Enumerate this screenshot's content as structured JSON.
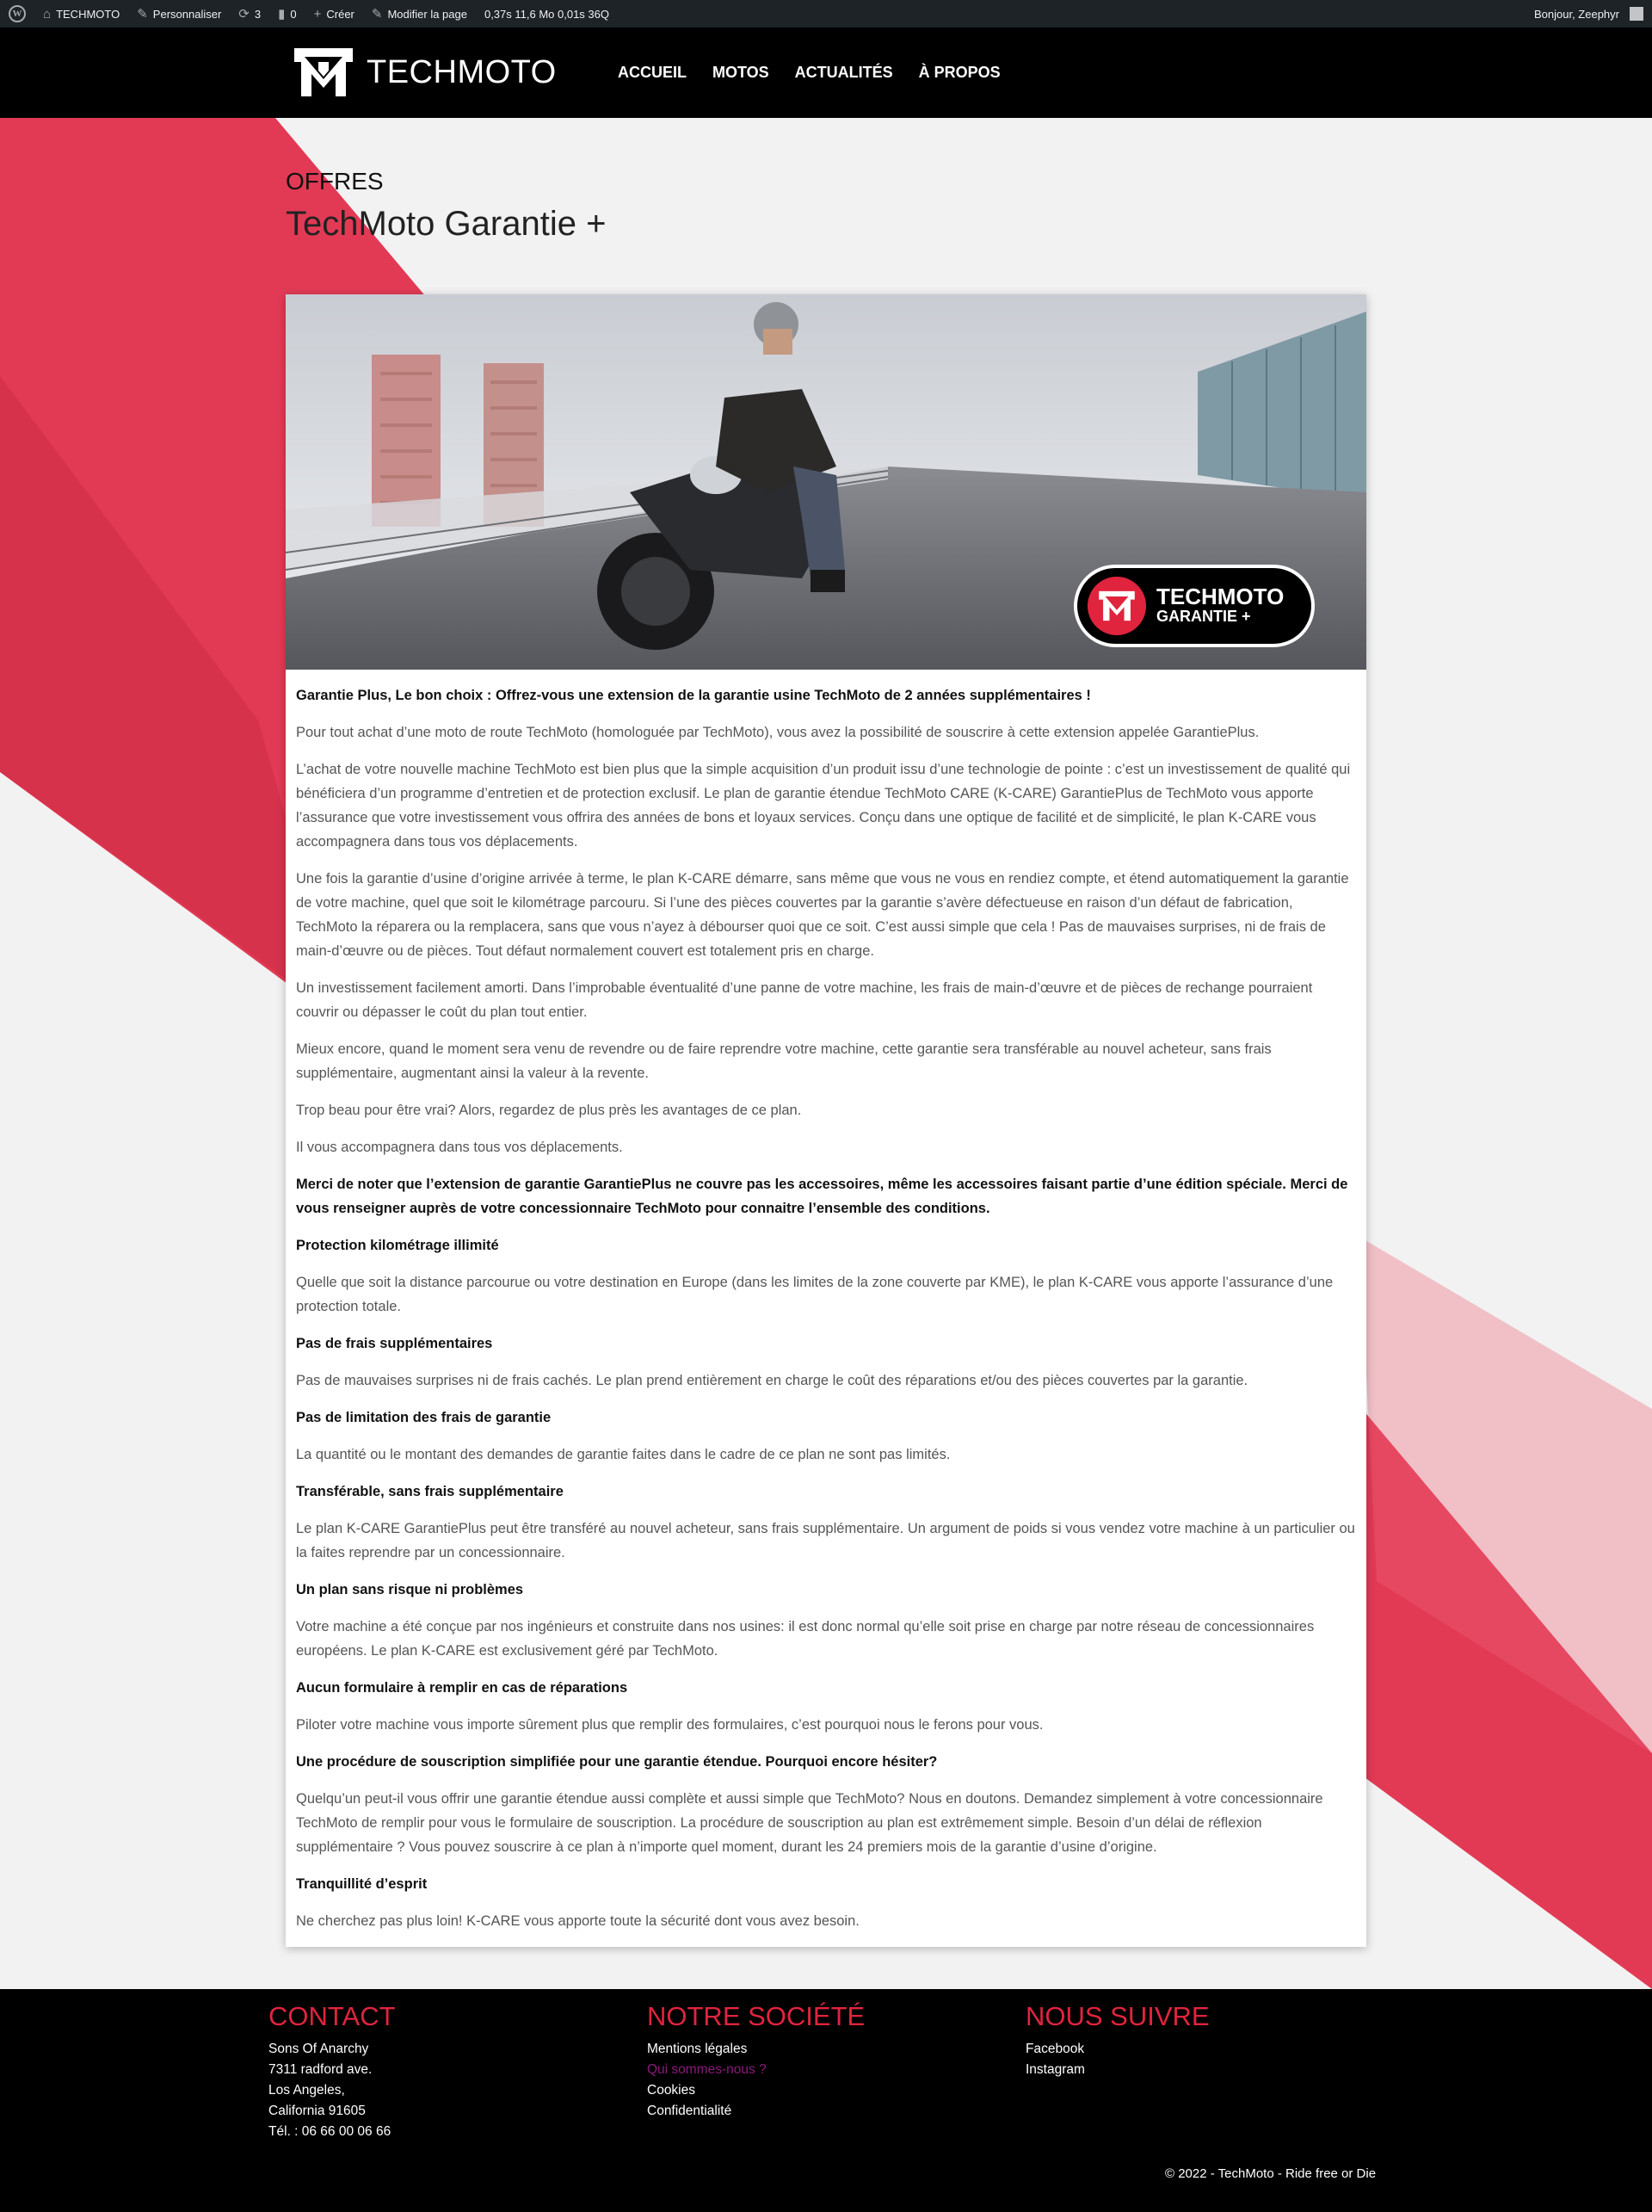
{
  "admin_bar": {
    "site_name": "TECHMOTO",
    "customize": "Personnaliser",
    "updates_count": "3",
    "comments_count": "0",
    "new": "Créer",
    "edit_page": "Modifier la page",
    "stats": "0,37s  11,6 Mo  0,01s  36Q",
    "greeting": "Bonjour, Zeephyr"
  },
  "header": {
    "brand": "TECHMOTO",
    "nav": [
      "ACCUEIL",
      "MOTOS",
      "ACTUALITÉS",
      "À PROPOS"
    ]
  },
  "page": {
    "kicker": "OFFRES",
    "title": "TechMoto Garantie +"
  },
  "hero": {
    "badge_brand": "TECHMOTO",
    "badge_product": "GARANTIE +"
  },
  "content": [
    {
      "bold": true,
      "text": "Garantie Plus, Le bon choix : Offrez-vous une extension de la garantie usine TechMoto de 2 années supplémentaires !"
    },
    {
      "bold": false,
      "text": "Pour tout achat d’une moto de route TechMoto (homologuée par TechMoto), vous avez la possibilité de souscrire à cette extension appelée GarantiePlus."
    },
    {
      "bold": false,
      "text": "L’achat de votre nouvelle machine TechMoto est bien plus que la simple acquisition d’un produit issu d’une technologie de pointe : c’est un investissement de qualité qui bénéficiera d’un programme d’entretien et de protection exclusif. Le plan de garantie étendue TechMoto CARE (K-CARE) GarantiePlus de TechMoto vous apporte l’assurance que votre investissement vous offrira des années de bons et loyaux services. Conçu dans une optique de facilité et de simplicité, le plan K-CARE vous accompagnera dans tous vos déplacements."
    },
    {
      "bold": false,
      "text": "Une fois la garantie d’usine d’origine arrivée à terme, le plan K-CARE démarre, sans même que vous ne vous en rendiez compte, et étend automatiquement la garantie de votre machine, quel que soit le kilométrage parcouru. Si l’une des pièces couvertes par la garantie s’avère défectueuse en raison d’un défaut de fabrication, TechMoto la réparera ou la remplacera, sans que vous n’ayez à débourser quoi que ce soit. C’est aussi simple que cela ! Pas de mauvaises surprises, ni de frais de main-d’œuvre ou de pièces. Tout défaut normalement couvert est totalement pris en charge."
    },
    {
      "bold": false,
      "text": "Un investissement facilement amorti. Dans l’improbable éventualité d’une panne de votre machine, les frais de main-d’œuvre et de pièces de rechange pourraient couvrir ou dépasser le coût du plan tout entier."
    },
    {
      "bold": false,
      "text": "Mieux encore, quand le moment sera venu de revendre ou de faire reprendre votre machine, cette garantie sera transférable au nouvel acheteur, sans frais supplémentaire, augmentant ainsi la valeur à la revente."
    },
    {
      "bold": false,
      "text": "Trop beau pour être vrai? Alors, regardez de plus près les avantages de ce plan."
    },
    {
      "bold": false,
      "text": "Il vous accompagnera dans tous vos déplacements."
    },
    {
      "bold": true,
      "text": "Merci de noter que l’extension de garantie GarantiePlus ne couvre pas les accessoires, même les accessoires faisant partie d’une édition spéciale. Merci de vous renseigner auprès de votre concessionnaire TechMoto pour connaitre l’ensemble des conditions."
    },
    {
      "bold": true,
      "text": "Protection kilométrage illimité"
    },
    {
      "bold": false,
      "text": "Quelle que soit la distance parcourue ou votre destination en Europe (dans les limites de la zone couverte par KME), le plan K-CARE vous apporte l’assurance d’une protection totale."
    },
    {
      "bold": true,
      "text": "Pas de frais supplémentaires"
    },
    {
      "bold": false,
      "text": "Pas de mauvaises surprises ni de frais cachés. Le plan prend entièrement en charge le coût des réparations et/ou des pièces couvertes par la garantie."
    },
    {
      "bold": true,
      "text": "Pas de limitation des frais de garantie"
    },
    {
      "bold": false,
      "text": "La quantité ou le montant des demandes de garantie faites dans le cadre de ce plan ne sont pas limités."
    },
    {
      "bold": true,
      "text": "Transférable, sans frais supplémentaire"
    },
    {
      "bold": false,
      "text": "Le plan K-CARE GarantiePlus peut être transféré au nouvel acheteur, sans frais supplémentaire. Un argument de poids si vous vendez votre machine à un particulier ou la faites reprendre par un concessionnaire."
    },
    {
      "bold": true,
      "text": "Un plan sans risque ni problèmes"
    },
    {
      "bold": false,
      "text": "Votre machine a été conçue par nos ingénieurs et construite dans nos usines: il est donc normal qu’elle soit prise en charge par notre réseau de concessionnaires européens. Le plan K-CARE est exclusivement géré par TechMoto."
    },
    {
      "bold": true,
      "text": "Aucun formulaire à remplir en cas de réparations"
    },
    {
      "bold": false,
      "text": "Piloter votre machine vous importe sûrement plus que remplir des formulaires, c’est pourquoi nous le ferons pour vous."
    },
    {
      "bold": true,
      "text": "Une procédure de souscription simplifiée pour une garantie étendue. Pourquoi encore hésiter?"
    },
    {
      "bold": false,
      "text": "Quelqu’un peut-il vous offrir une garantie étendue aussi complète et aussi simple que TechMoto? Nous en doutons. Demandez simplement à votre concessionnaire TechMoto de remplir pour vous le formulaire de souscription. La procédure de souscription au plan est extrêmement simple. Besoin d’un délai de réflexion supplémentaire ? Vous pouvez souscrire à ce plan à n’importe quel moment, durant les 24 premiers mois de la garantie d’usine d’origine."
    },
    {
      "bold": true,
      "text": "Tranquillité d’esprit"
    },
    {
      "bold": false,
      "text": "Ne cherchez pas plus loin! K-CARE vous apporte toute la sécurité dont vous avez besoin."
    }
  ],
  "footer": {
    "contact": {
      "title": "CONTACT",
      "lines": [
        "Sons Of Anarchy",
        "7311 radford ave.",
        "Los Angeles,",
        "California 91605",
        "Tél. : 06 66 00 06 66"
      ]
    },
    "company": {
      "title": "NOTRE SOCIÉTÉ",
      "links": [
        "Mentions légales",
        "Qui sommes-nous ?",
        "Cookies",
        "Confidentialité"
      ]
    },
    "follow": {
      "title": "NOUS SUIVRE",
      "links": [
        "Facebook",
        "Instagram"
      ]
    },
    "copyright": "© 2022 - TechMoto - Ride free or Die"
  },
  "colors": {
    "accent": "#e0243e",
    "header_bg": "#000000",
    "admin_bg": "#1d2327",
    "visited_link": "#8a1a7a"
  }
}
